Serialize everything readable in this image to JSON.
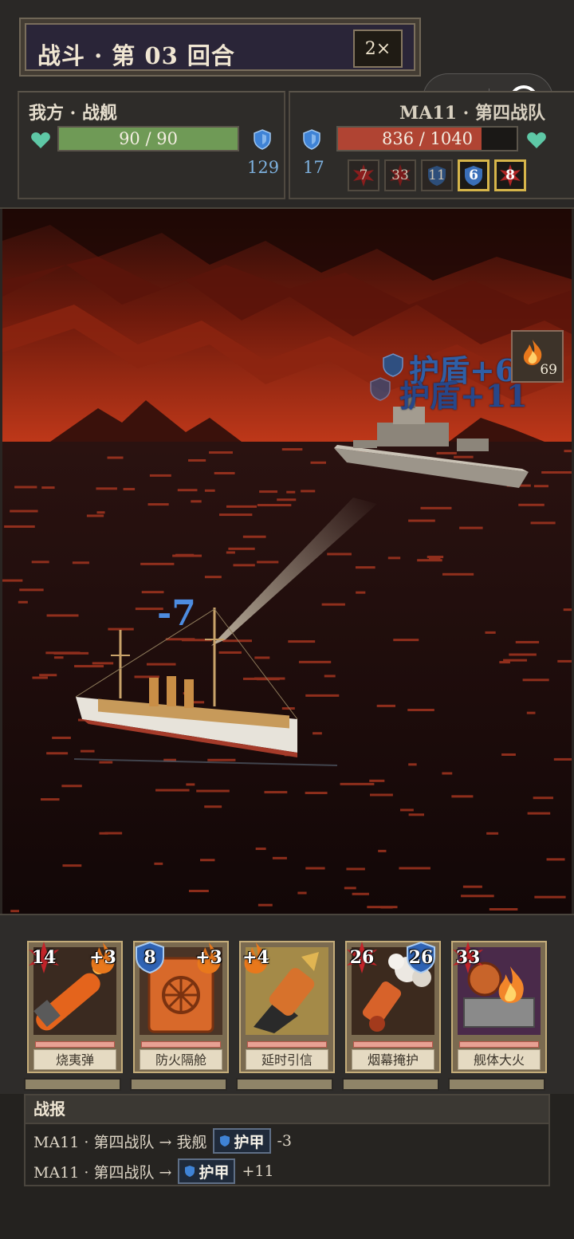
{
  "header": {
    "title": "战斗 · 第 03 回合",
    "speed_label": "2×"
  },
  "player": {
    "name": "我方 · 战舰",
    "hp_text": "90 / 90",
    "hp_fraction": 1.0,
    "block": "129",
    "hp_color": "#6f9a56"
  },
  "enemy": {
    "name": "MA11 · 第四战队",
    "hp_text": "836 / 1040",
    "hp_fraction": 0.804,
    "block": "17",
    "hp_color": "#b04433",
    "statuses": [
      {
        "value": "7",
        "active": false
      },
      {
        "value": "33",
        "active": false
      },
      {
        "value": "11",
        "active": false
      },
      {
        "value": "6",
        "active": true
      },
      {
        "value": "8",
        "active": true
      }
    ]
  },
  "scene": {
    "float_shield_1": "护盾+6",
    "float_shield_2": "护盾+11",
    "float_damage": "-7",
    "burn_count": "69"
  },
  "cards": [
    {
      "name": "烧夷弹",
      "left_badge": "14",
      "right_badge": "+3"
    },
    {
      "name": "防火隔舱",
      "left_badge": "8",
      "right_badge": "+3"
    },
    {
      "name": "延时引信",
      "left_badge": "+4",
      "right_badge": ""
    },
    {
      "name": "烟幕掩护",
      "left_badge": "26",
      "right_badge": "26"
    },
    {
      "name": "舰体大火",
      "left_badge": "33",
      "right_badge": ""
    }
  ],
  "log": {
    "title": "战报",
    "lines": [
      {
        "prefix": "MA11 · 第四战队 → 我舰",
        "tag": "护甲",
        "value": "-3"
      },
      {
        "prefix": "MA11 · 第四战队 →",
        "tag": "护甲",
        "value": "+11"
      }
    ]
  },
  "colors": {
    "heart": "#5ec8a6",
    "shield": "#3f83d6",
    "active_status_border": "#d6b54a",
    "card_frame": "#c5ad7a"
  }
}
